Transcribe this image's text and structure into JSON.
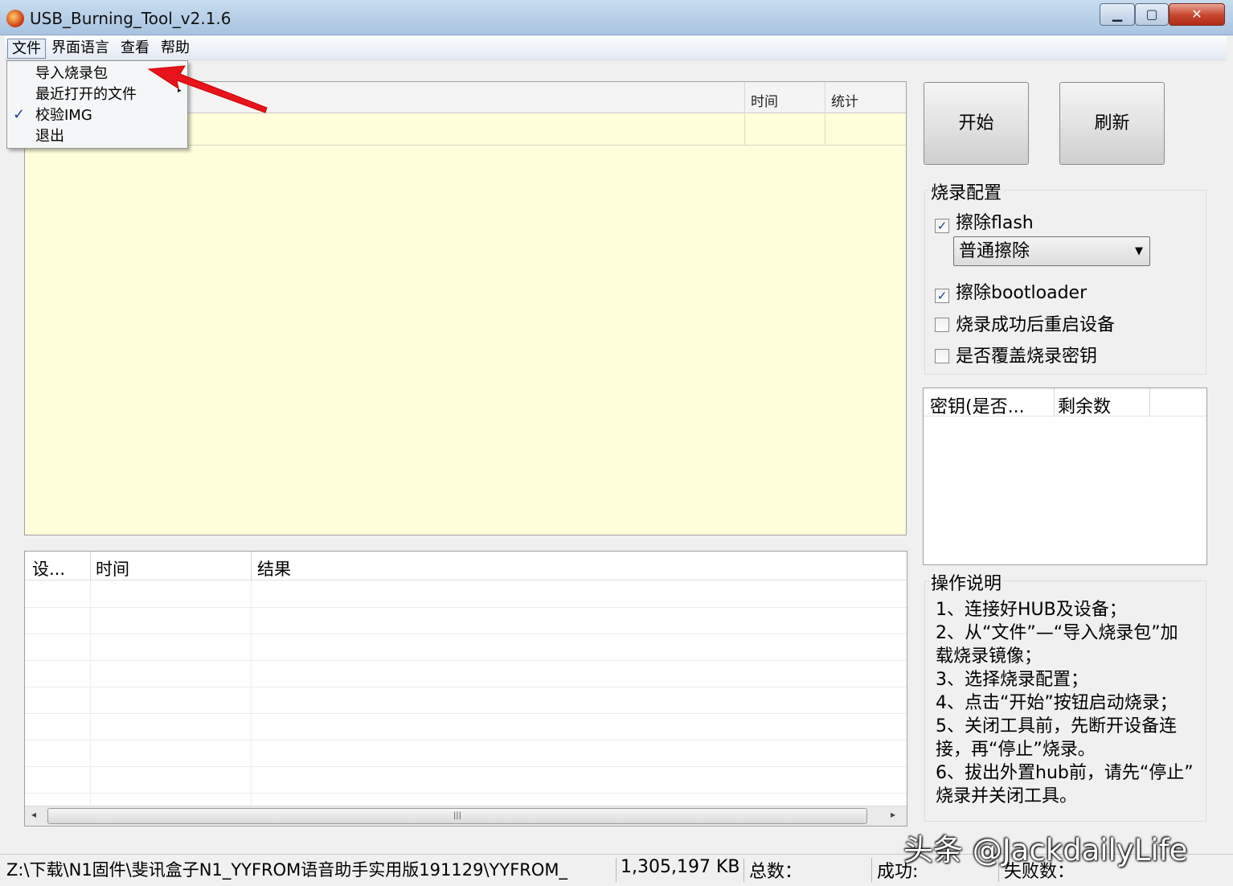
{
  "window": {
    "title": "USB_Burning_Tool_v2.1.6",
    "controls": {
      "minimize": "▁",
      "maximize": "▢",
      "close": "✕"
    }
  },
  "menubar": {
    "items": [
      "文件",
      "界面语言",
      "查看",
      "帮助"
    ]
  },
  "file_menu": {
    "items": [
      "导入烧录包",
      "最近打开的文件",
      "校验IMG",
      "退出"
    ],
    "checked_item": "校验IMG",
    "checkmark": "✓",
    "submenu_arrow": "▸"
  },
  "device_list": {
    "columns": [
      "时间",
      "统计"
    ]
  },
  "log_table": {
    "columns": [
      "设...",
      "时间",
      "结果"
    ],
    "scroll_grip": "|||",
    "scroll_left": "◂",
    "scroll_right": "▸"
  },
  "buttons": {
    "start": "开始",
    "refresh": "刷新"
  },
  "burn_config": {
    "title": "烧录配置",
    "erase_flash": {
      "label": "擦除flash",
      "checked": true
    },
    "erase_mode": "普通擦除",
    "erase_mode_arrow": "▼",
    "erase_bootloader": {
      "label": "擦除bootloader",
      "checked": true
    },
    "reboot_after": {
      "label": "烧录成功后重启设备",
      "checked": false
    },
    "overwrite_key": {
      "label": "是否覆盖烧录密钥",
      "checked": false
    },
    "check_mark": "✓"
  },
  "key_table": {
    "columns": [
      "密钥(是否...",
      "剩余数"
    ]
  },
  "instructions": {
    "title": "操作说明",
    "lines": [
      "1、连接好HUB及设备；",
      "2、从“文件”—“导入烧录包”加",
      "载烧录镜像；",
      "3、选择烧录配置；",
      "4、点击“开始”按钮启动烧录；",
      "5、关闭工具前，先断开设备连",
      "接，再“停止”烧录。",
      "6、拔出外置hub前，请先“停止”",
      "烧录并关闭工具。"
    ]
  },
  "statusbar": {
    "path": "Z:\\下载\\N1固件\\斐讯盒子N1_YYFROM语音助手实用版191129\\YYFROM_",
    "size": "1,305,197 KB",
    "total": "总数：",
    "success": "成功:",
    "fail": "失败数："
  },
  "watermark": "头条 @JackdailyLife",
  "colors": {
    "accent_arrow": "#e8141c",
    "panel_yellow": "#ffffdc"
  }
}
